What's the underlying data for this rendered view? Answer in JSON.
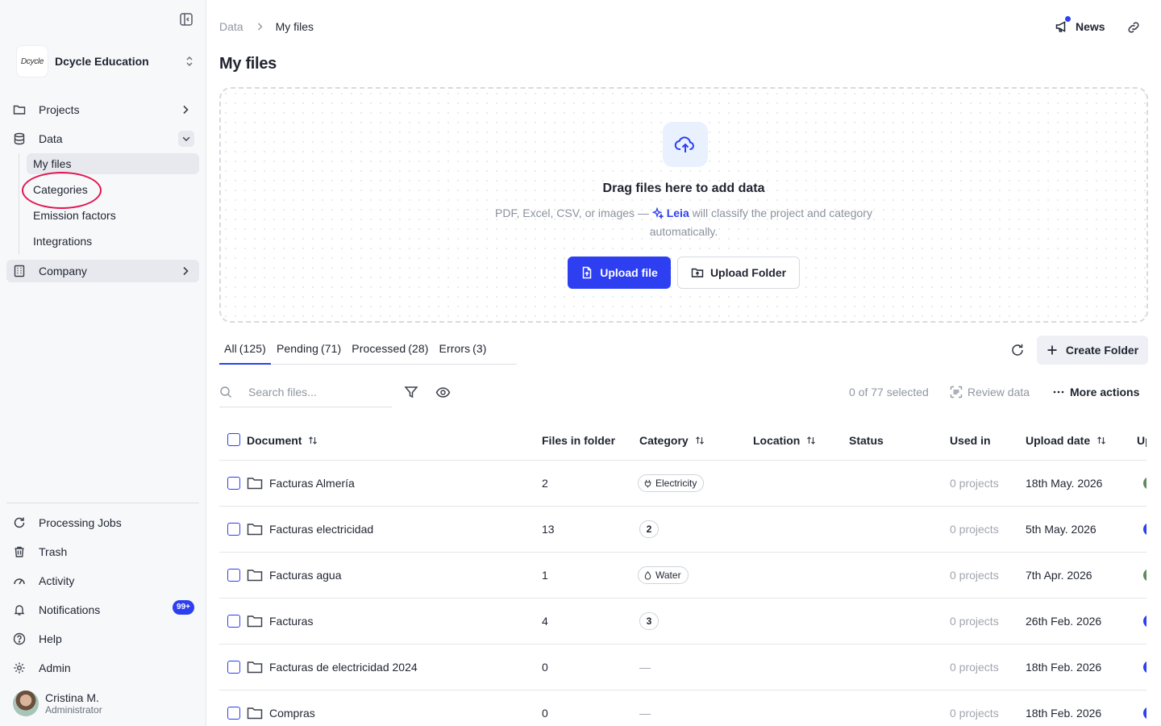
{
  "org": {
    "logo_text": "Dcycle",
    "name": "Dcycle Education"
  },
  "nav": {
    "projects": "Projects",
    "data": "Data",
    "data_sub": [
      "My files",
      "Categories",
      "Emission factors",
      "Integrations"
    ],
    "company": "Company"
  },
  "bottom_nav": {
    "processing_jobs": "Processing Jobs",
    "trash": "Trash",
    "activity": "Activity",
    "notifications": "Notifications",
    "notifications_badge": "99+",
    "help": "Help",
    "admin": "Admin"
  },
  "user": {
    "name": "Cristina M.",
    "role": "Administrator"
  },
  "breadcrumb": {
    "root": "Data",
    "current": "My files"
  },
  "header": {
    "news": "News",
    "accent": "#2d3ff0"
  },
  "page_title": "My files",
  "dropzone": {
    "title": "Drag files here to add data",
    "desc_before": "PDF, Excel, CSV, or images —",
    "leia": "Leia",
    "desc_after": "will classify the project and category automatically.",
    "upload_file": "Upload file",
    "upload_folder": "Upload Folder"
  },
  "tabs": [
    {
      "label": "All",
      "count": "(125)"
    },
    {
      "label": "Pending",
      "count": "(71)"
    },
    {
      "label": "Processed",
      "count": "(28)"
    },
    {
      "label": "Errors",
      "count": "(3)"
    }
  ],
  "create_folder": "Create Folder",
  "search": {
    "placeholder": "Search files..."
  },
  "toolbar": {
    "selected": "0 of 77 selected",
    "review": "Review data",
    "more": "More actions"
  },
  "columns": {
    "document": "Document",
    "files_in_folder": "Files in folder",
    "category": "Category",
    "location": "Location",
    "status": "Status",
    "used_in": "Used in",
    "upload_date": "Upload date",
    "uploaded_by": "Up"
  },
  "rows": [
    {
      "name": "Facturas Almería",
      "files": "2",
      "category": "Electricity",
      "category_type": "electricity",
      "used_in": "0 projects",
      "date": "18th May. 2026",
      "uploader_color": "#5f8a5c"
    },
    {
      "name": "Facturas electricidad",
      "files": "13",
      "category_count": "2",
      "used_in": "0 projects",
      "date": "5th May. 2026",
      "uploader_color": "#2d3ff0"
    },
    {
      "name": "Facturas agua",
      "files": "1",
      "category": "Water",
      "category_type": "water",
      "used_in": "0 projects",
      "date": "7th Apr. 2026",
      "uploader_color": "#5f8a5c"
    },
    {
      "name": "Facturas",
      "files": "4",
      "category_count": "3",
      "used_in": "0 projects",
      "date": "26th Feb. 2026",
      "uploader_color": "#2d3ff0"
    },
    {
      "name": "Facturas de electricidad 2024",
      "files": "0",
      "category_empty": "—",
      "used_in": "0 projects",
      "date": "18th Feb. 2026",
      "uploader_color": "#2d3ff0"
    },
    {
      "name": "Compras",
      "files": "0",
      "category_empty": "—",
      "used_in": "0 projects",
      "date": "18th Feb. 2026",
      "uploader_color": "#2d3ff0"
    }
  ]
}
